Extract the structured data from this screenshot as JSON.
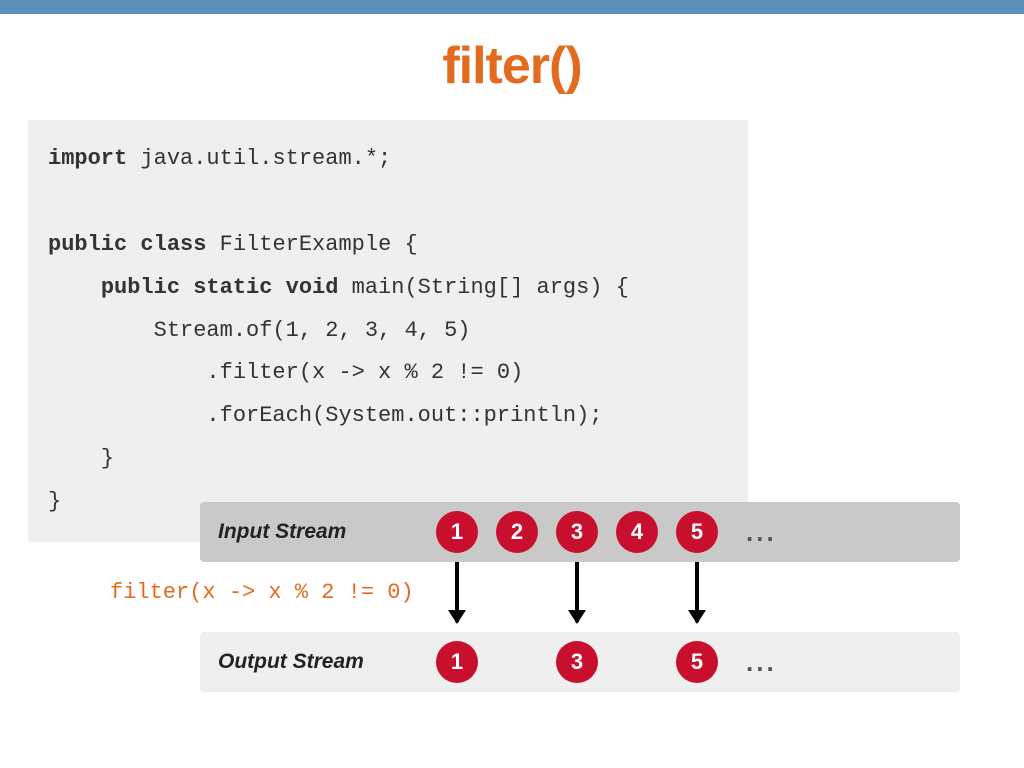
{
  "title": "filter()",
  "code": {
    "l1_kw1": "import",
    "l1_rest": " java.util.stream.*;",
    "l2_kw1": "public class",
    "l2_rest": " FilterExample {",
    "l3_kw1": "public static void",
    "l3_rest": " main(String[] args) {",
    "l4": "        Stream.of(1, 2, 3, 4, 5)",
    "l5": "            .filter(x -> x % 2 != 0)",
    "l6": "            .forEach(System.out::println);",
    "l7": "    }",
    "l8": "}"
  },
  "diagram": {
    "input_label": "Input Stream",
    "output_label": "Output Stream",
    "input_values": [
      "1",
      "2",
      "3",
      "4",
      "5"
    ],
    "output_values": [
      "1",
      "",
      "3",
      "",
      "5"
    ],
    "ellipsis": "...",
    "filter_expr": "filter(x -> x % 2 != 0)"
  },
  "colors": {
    "accent": "#e36b1f",
    "bubble": "#c8102e",
    "bar": "#5b8fb9"
  }
}
